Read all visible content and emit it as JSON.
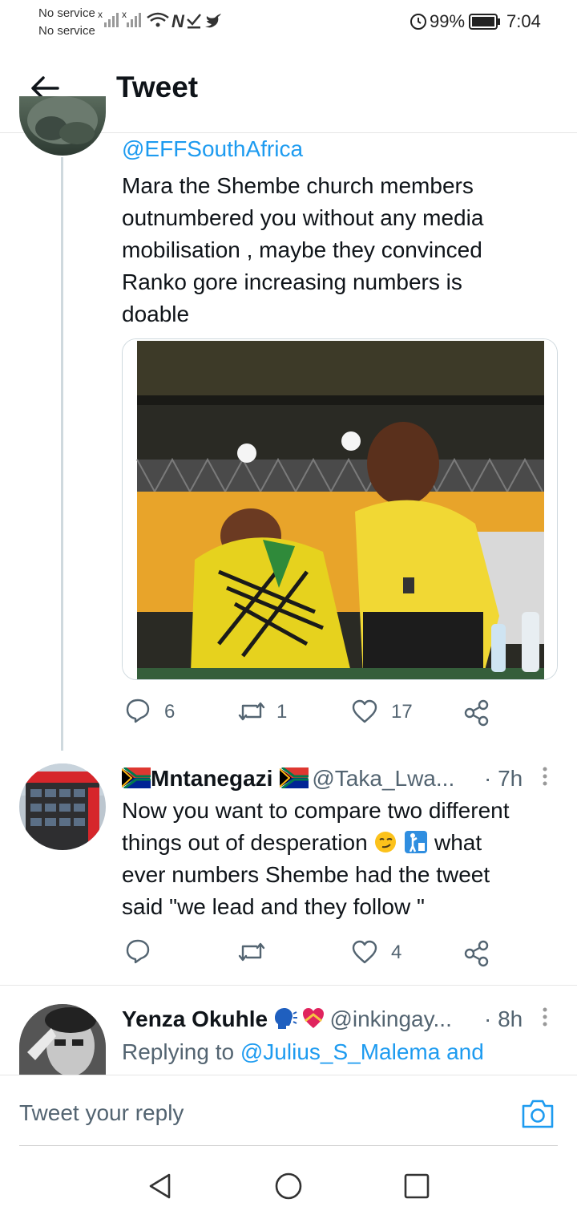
{
  "status_bar": {
    "carrier_1": "No service",
    "carrier_2": "No service",
    "battery": "99%",
    "time": "7:04"
  },
  "header": {
    "title": "Tweet",
    "back_icon": "arrow-left-icon"
  },
  "tweet_1": {
    "mention": "@EFFSouthAfrica",
    "text_lines": [
      "Mara the Shembe church members",
      "outnumbered you without any media",
      "mobilisation , maybe they convinced",
      "Ranko gore increasing numbers is",
      "doable"
    ],
    "actions": {
      "replies": "6",
      "retweets": "1",
      "likes": "17"
    }
  },
  "tweet_2": {
    "name": "Mntanegazi",
    "handle": "@Taka_Lwa...",
    "time": "· 7h",
    "text_lines": [
      "Now you want to compare two different",
      "things out of desperation",
      "what",
      "ever numbers Shembe had the tweet",
      "said \"we lead and they follow \""
    ],
    "actions": {
      "replies": "",
      "retweets": "",
      "likes": "4"
    }
  },
  "tweet_3": {
    "name": "Yenza Okuhle",
    "handle": "@inkingay...",
    "time": "· 8h",
    "replying_prefix": "Replying to",
    "replying_link": "@Julius_S_Malema and"
  },
  "reply_bar": {
    "placeholder": "Tweet your reply"
  },
  "colors": {
    "accent": "#1d9bf0",
    "text": "#0f1419",
    "muted": "#536471"
  }
}
